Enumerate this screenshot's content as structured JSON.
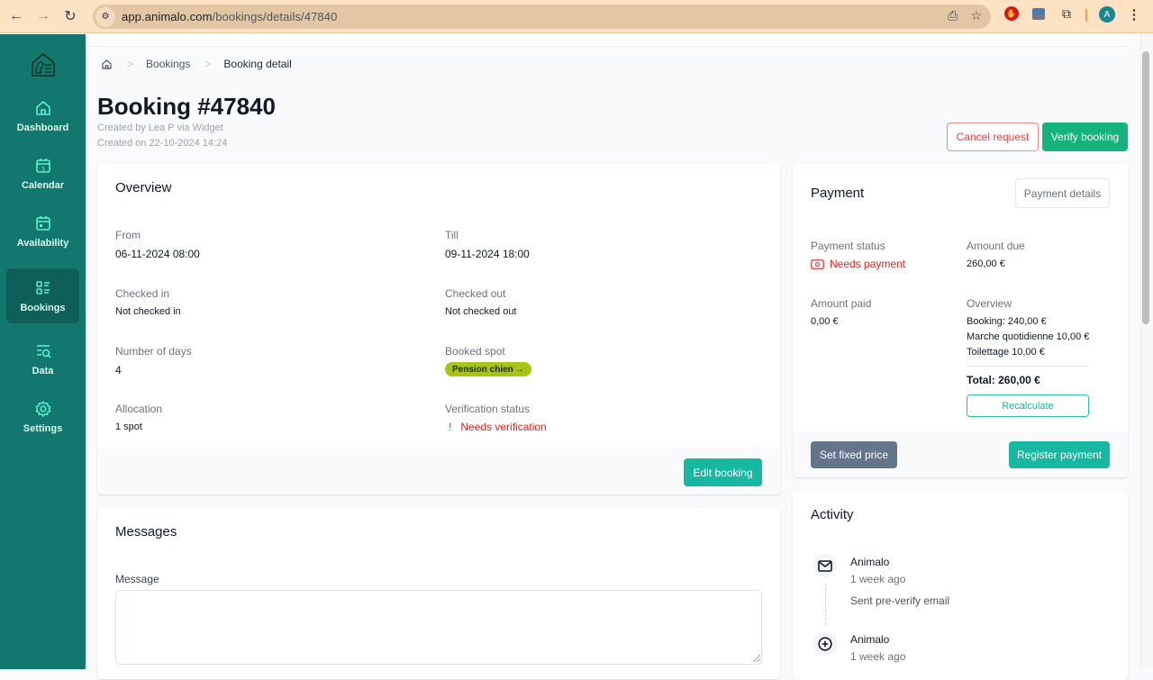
{
  "browser": {
    "url_host": "app.animalo.com",
    "url_path": "/bookings/details/47840",
    "profile_initial": "A"
  },
  "sidebar": {
    "items": [
      {
        "label": "Dashboard",
        "icon": "home-icon"
      },
      {
        "label": "Calendar",
        "icon": "calendar-icon"
      },
      {
        "label": "Availability",
        "icon": "calendar-availability-icon"
      },
      {
        "label": "Bookings",
        "icon": "list-icon",
        "active": true
      },
      {
        "label": "Data",
        "icon": "data-search-icon"
      },
      {
        "label": "Settings",
        "icon": "gear-icon"
      }
    ]
  },
  "breadcrumb": {
    "items": [
      "Bookings",
      "Booking detail"
    ]
  },
  "header": {
    "title": "Booking #47840",
    "created_by": "Created by Lea P via Widget",
    "created_on": "Created on 22-10-2024 14:24",
    "cancel_label": "Cancel request",
    "verify_label": "Verify booking"
  },
  "overview": {
    "title": "Overview",
    "from_label": "From",
    "from_value": "06-11-2024 08:00",
    "till_label": "Till",
    "till_value": "09-11-2024 18:00",
    "checked_in_label": "Checked in",
    "checked_in_value": "Not checked in",
    "checked_out_label": "Checked out",
    "checked_out_value": "Not checked out",
    "days_label": "Number of days",
    "days_value": "4",
    "spot_label": "Booked spot",
    "spot_value": "Pension chien",
    "spot_arrow": "→",
    "allocation_label": "Allocation",
    "allocation_value": "1 spot",
    "verification_label": "Verification status",
    "verification_icon": "!",
    "verification_value": "Needs verification",
    "edit_label": "Edit booking"
  },
  "messages": {
    "title": "Messages",
    "message_label": "Message",
    "message_value": "",
    "message_placeholder": ""
  },
  "payment": {
    "title": "Payment",
    "details_label": "Payment details",
    "status_label": "Payment status",
    "status_value": "Needs payment",
    "amount_due_label": "Amount due",
    "amount_due_value": "260,00 €",
    "amount_paid_label": "Amount paid",
    "amount_paid_value": "0,00 €",
    "overview_label": "Overview",
    "lines": [
      "Booking: 240,00 €",
      "Marche quotidienne 10,00 €",
      "Toilettage 10,00 €"
    ],
    "total": "Total: 260,00 €",
    "recalculate_label": "Recalculate",
    "fixed_price_label": "Set fixed price",
    "register_label": "Register payment"
  },
  "activity": {
    "title": "Activity",
    "items": [
      {
        "name": "Animalo",
        "time": "1 week ago",
        "text": "Sent pre-verify email",
        "icon": "mail-icon"
      },
      {
        "name": "Animalo",
        "time": "1 week ago",
        "text": "",
        "icon": "plus-circle-icon"
      }
    ]
  },
  "colors": {
    "sidebar": "#12786d",
    "primary": "#16b27b",
    "teal": "#17b8a2",
    "danger": "#dc2626",
    "spot_badge": "#a8c515"
  }
}
